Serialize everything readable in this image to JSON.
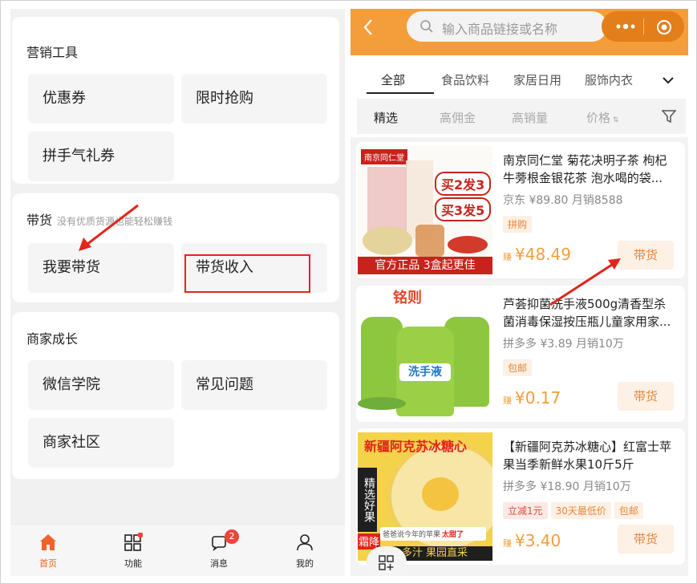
{
  "left": {
    "marketing": {
      "title": "营销工具",
      "items": [
        "优惠券",
        "限时抢购",
        "拼手气礼券"
      ]
    },
    "carry": {
      "title": "带货",
      "hint": "没有优质货源也能轻松赚钱",
      "items": [
        "我要带货",
        "带货收入"
      ]
    },
    "growth": {
      "title": "商家成长",
      "items": [
        "微信学院",
        "常见问题",
        "商家社区"
      ]
    },
    "tabbar": {
      "items": [
        "首页",
        "功能",
        "消息",
        "我的"
      ],
      "message_badge": "2"
    }
  },
  "right": {
    "search": {
      "placeholder": "输入商品链接或名称"
    },
    "categories": [
      "全部",
      "食品饮料",
      "家居日用",
      "服饰内衣"
    ],
    "subtabs": [
      "精选",
      "高佣金",
      "高销量",
      "价格"
    ],
    "products": [
      {
        "title": "南京同仁堂 菊花决明子茶 枸杞牛蒡根金银花茶 泡水喝的袋...",
        "source": "京东 ¥89.80  月销8588",
        "tags": [
          "拼购"
        ],
        "earn": "赚",
        "price": "¥48.49",
        "button": "带货",
        "image_text": {
          "brand": "南京同仁堂",
          "badge1": "买2发3",
          "badge2": "买3发5",
          "banner": "官方正品  3盒起更佳"
        }
      },
      {
        "title": "芦荟抑菌洗手液500g清香型杀菌消毒保湿按压瓶儿童家用家...",
        "source": "拼多多 ¥3.89  月销10万",
        "tags": [
          "包邮"
        ],
        "earn": "赚",
        "price": "¥0.17",
        "button": "带货",
        "image_text": {
          "brand": "铭则",
          "label": "洗手液"
        }
      },
      {
        "title": "【新疆阿克苏冰糖心】红富士苹果当季新鲜水果10斤5斤",
        "source": "拼多多 ¥18.90  月销10万",
        "tags": [
          "立减1元",
          "30天最低价",
          "包邮"
        ],
        "earn": "赚",
        "price": "¥3.40",
        "button": "带货",
        "image_text": {
          "headline": "新疆阿克苏冰糖心",
          "side": "精选好果",
          "bottom": "多汁  果园直采",
          "sweet": "太甜了",
          "note": "爸爸说今年的苹果",
          "corner": "霜降"
        }
      }
    ]
  },
  "colors": {
    "accent": "#f39e3b",
    "annotation": "#e0261b"
  }
}
